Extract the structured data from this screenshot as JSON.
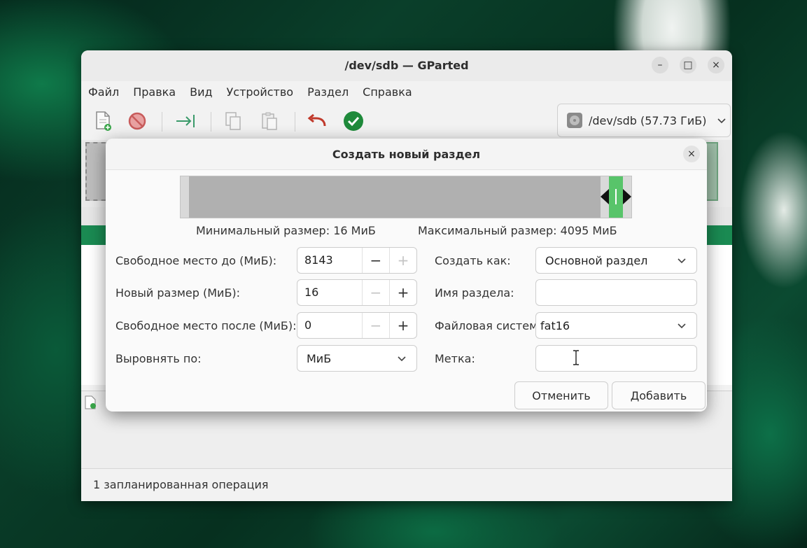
{
  "window": {
    "title": "/dev/sdb — GParted",
    "controls": {
      "minimize": "–",
      "maximize": "□",
      "close": "×"
    }
  },
  "menu": [
    "Файл",
    "Правка",
    "Вид",
    "Устройство",
    "Раздел",
    "Справка"
  ],
  "toolbar": {
    "icons": [
      "new-partition-icon",
      "delete-icon",
      "resize-move-icon",
      "copy-icon",
      "paste-icon",
      "undo-icon",
      "apply-icon"
    ],
    "device": "/dev/sdb (57.73 ГиБ)"
  },
  "colors": {
    "accent_green": "#1a8a52",
    "partition_green": "#58c46a",
    "undo_red": "#c0392b",
    "apply_green": "#1f8a3b"
  },
  "status": "1 запланированная операция",
  "dialog": {
    "title": "Создать новый раздел",
    "close": "×",
    "min_size": "Минимальный размер: 16 МиБ",
    "max_size": "Максимальный размер: 4095 МиБ",
    "fields": {
      "free_before": {
        "label": "Свободное место до (МиБ):",
        "value": "8143"
      },
      "new_size": {
        "label": "Новый размер (МиБ):",
        "value": "16"
      },
      "free_after": {
        "label": "Свободное место после (МиБ):",
        "value": "0"
      },
      "align": {
        "label": "Выровнять по:",
        "value": "МиБ"
      },
      "create_as": {
        "label": "Создать как:",
        "value": "Основной раздел"
      },
      "part_name": {
        "label": "Имя раздела:",
        "value": ""
      },
      "filesystem": {
        "label": "Файловая система:",
        "value": "fat16"
      },
      "fs_label": {
        "label": "Метка:",
        "value": ""
      }
    },
    "spin": {
      "minus": "−",
      "plus": "+"
    },
    "cancel": "Отменить",
    "add": "Добавить"
  }
}
